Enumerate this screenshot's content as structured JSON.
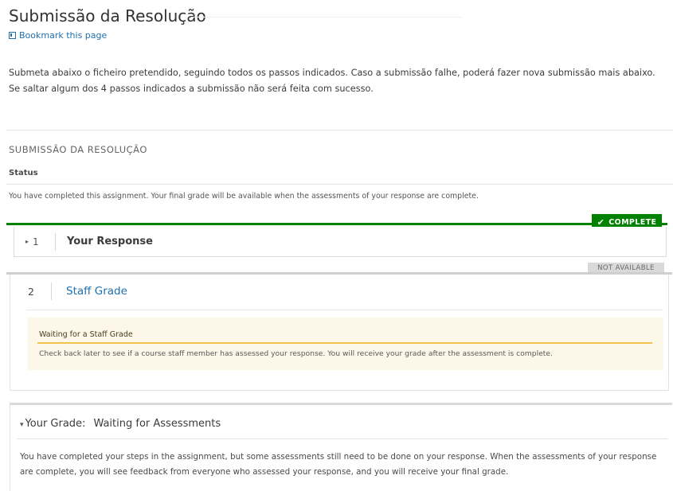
{
  "page": {
    "title": "Submissão da Resolução",
    "bookmark_label": "Bookmark this page",
    "intro_line1": "Submeta abaixo o ficheiro pretendido, seguindo todos os passos indicados. Caso a submissão falhe, poderá fazer nova submissão mais abaixo.",
    "intro_line2": "Se saltar algum dos 4 passos indicados a submissão não será feita com sucesso."
  },
  "section": {
    "heading": "SUBMISSÃO DA RESOLUÇÃO",
    "status_label": "Status",
    "status_text": "You have completed this assignment. Your final grade will be available when the assessments of your response are complete."
  },
  "steps": [
    {
      "number": "1",
      "title": "Your Response",
      "badge": "COMPLETE"
    },
    {
      "number": "2",
      "title": "Staff Grade",
      "badge": "NOT AVAILABLE",
      "waiting_title": "Waiting for a Staff Grade",
      "waiting_text": "Check back later to see if a course staff member has assessed your response. You will receive your grade after the assessment is complete."
    }
  ],
  "grade": {
    "label": "Your Grade:",
    "status": "Waiting for Assessments",
    "text": "You have completed your steps in the assignment, but some assessments still need to be done on your response. When the assessments of your response are complete, you will see feedback from everyone who assessed your response, and you will receive your final grade."
  },
  "colors": {
    "link": "#1f6fad",
    "complete": "#008100",
    "waiting_bg": "#fdf7ea",
    "waiting_accent": "#f0c34a"
  },
  "icons": {
    "bookmark": "bookmark-icon",
    "check": "check-icon",
    "caret": "caret-down-icon"
  }
}
